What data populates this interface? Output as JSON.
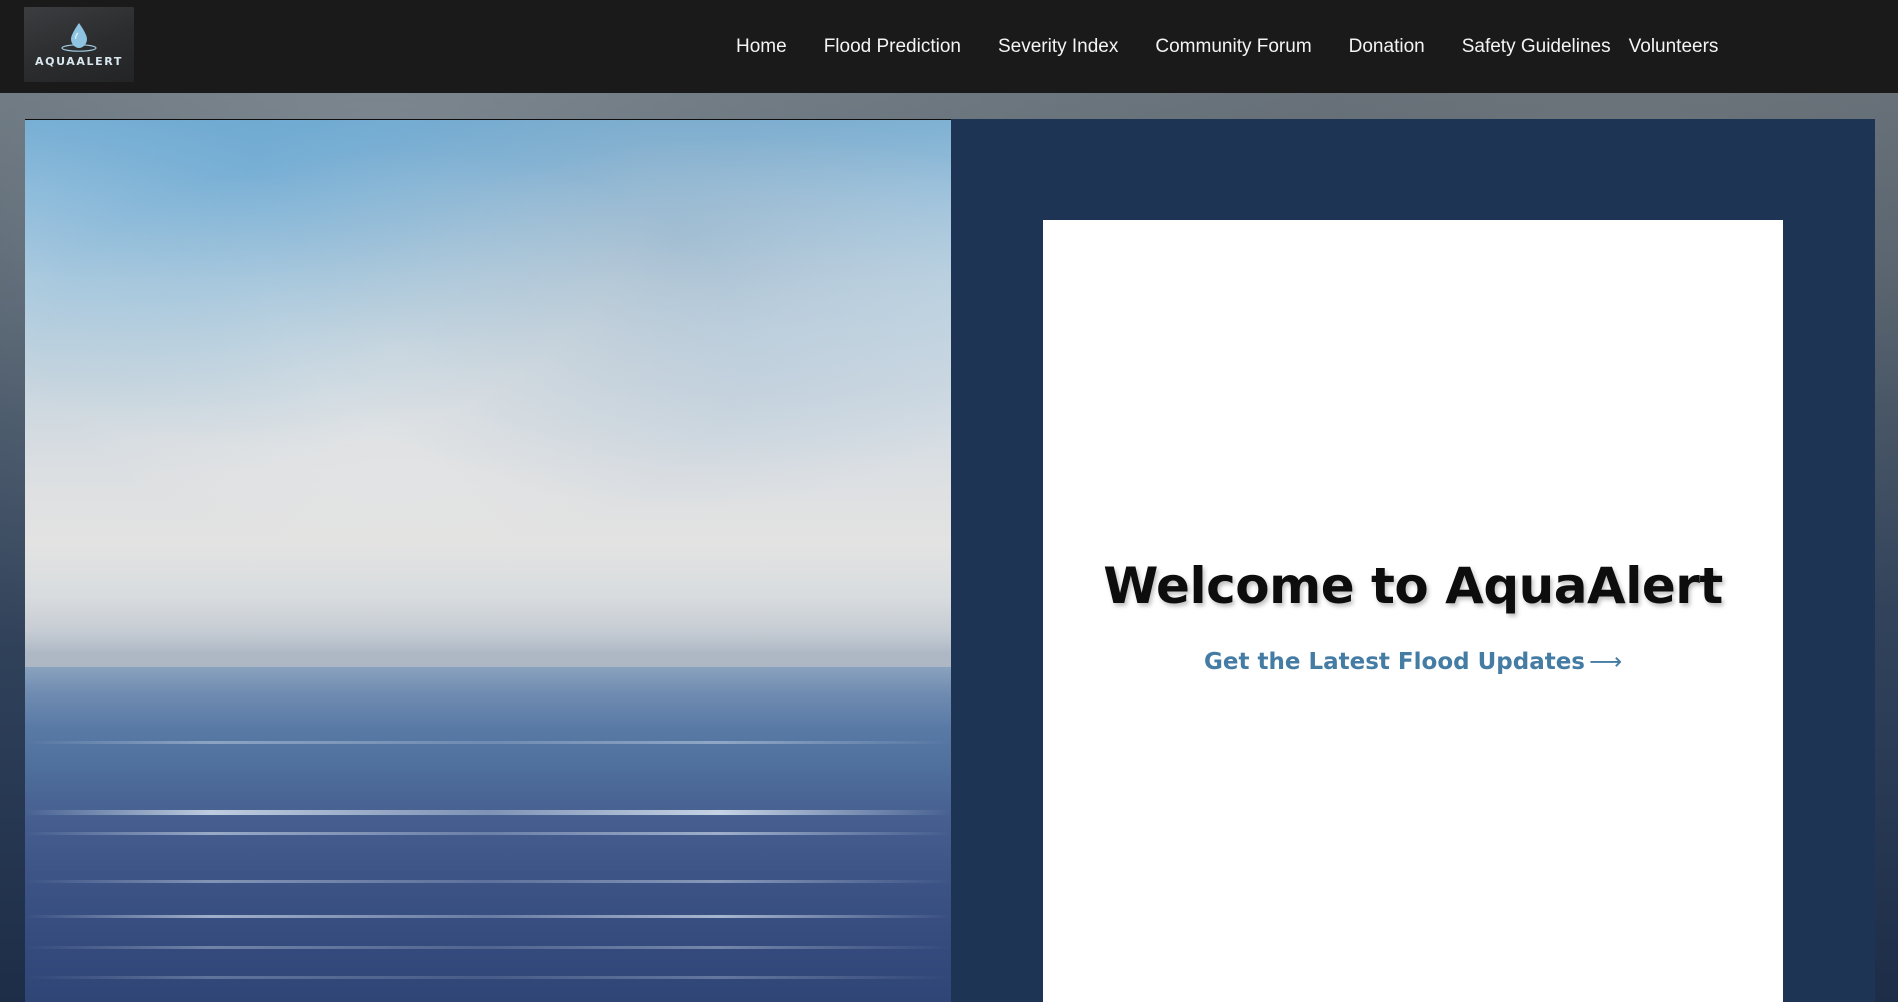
{
  "brand": {
    "logo_text": "AQUAALERT",
    "logo_icon": "water-drop-icon",
    "accent_color": "#457ca4"
  },
  "nav": {
    "items": [
      {
        "label": "Home"
      },
      {
        "label": "Flood Prediction"
      },
      {
        "label": "Severity Index"
      },
      {
        "label": "Community Forum"
      },
      {
        "label": "Donation"
      },
      {
        "label": "Safety Guidelines"
      },
      {
        "label": "Volunteers"
      }
    ]
  },
  "hero": {
    "title": "Welcome to AquaAlert",
    "cta_label": "Get the Latest Flood Updates",
    "cta_arrow": "⟶",
    "panel_color": "#1e3454",
    "card_color": "#ffffff"
  }
}
